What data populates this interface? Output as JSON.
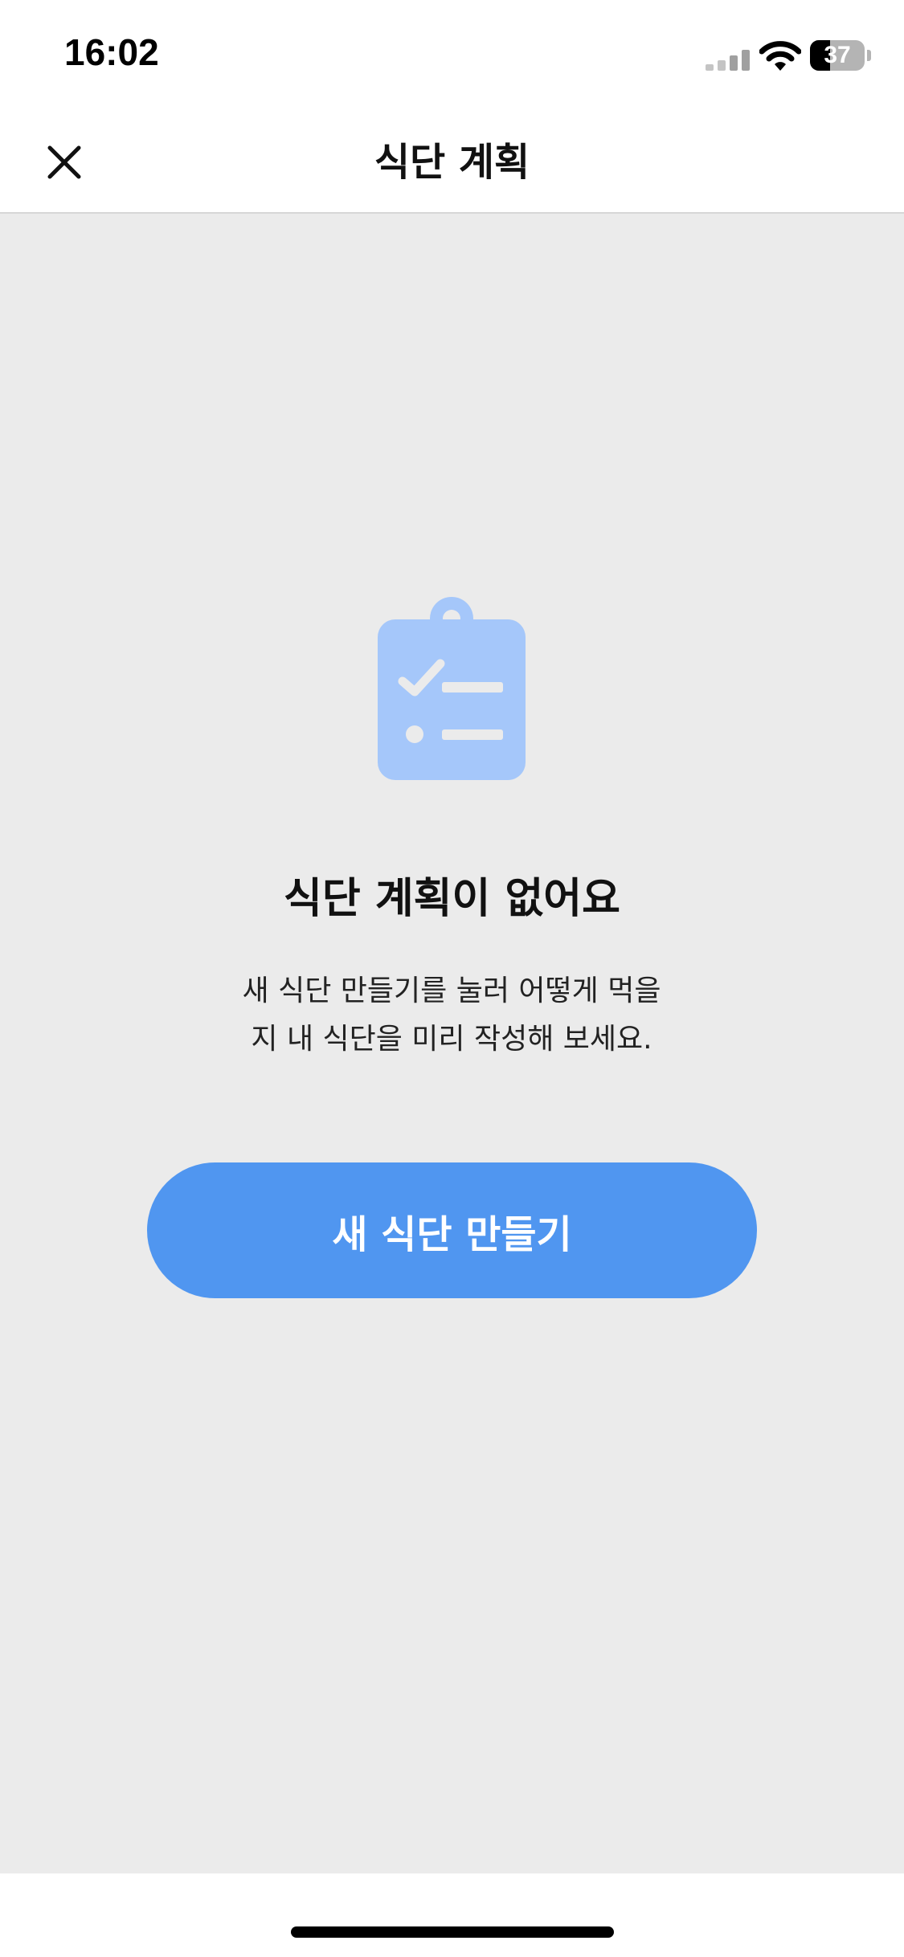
{
  "status_bar": {
    "time": "16:02",
    "battery_level": "37",
    "battery_fraction": 0.37,
    "signal_icon": "cellular-signal-icon",
    "wifi_icon": "wifi-icon"
  },
  "nav": {
    "title": "식단 계획",
    "close_icon": "close-icon"
  },
  "empty_state": {
    "icon": "clipboard-checklist-icon",
    "title": "식단 계획이 없어요",
    "description_line1": "새 식단 만들기를 눌러 어떻게 먹을",
    "description_line2": "지 내 식단을 미리 작성해 보세요.",
    "button_label": "새 식단 만들기"
  },
  "colors": {
    "accent": "#5096f0",
    "icon_fill": "#a5c7fa",
    "background": "#ebebeb"
  }
}
